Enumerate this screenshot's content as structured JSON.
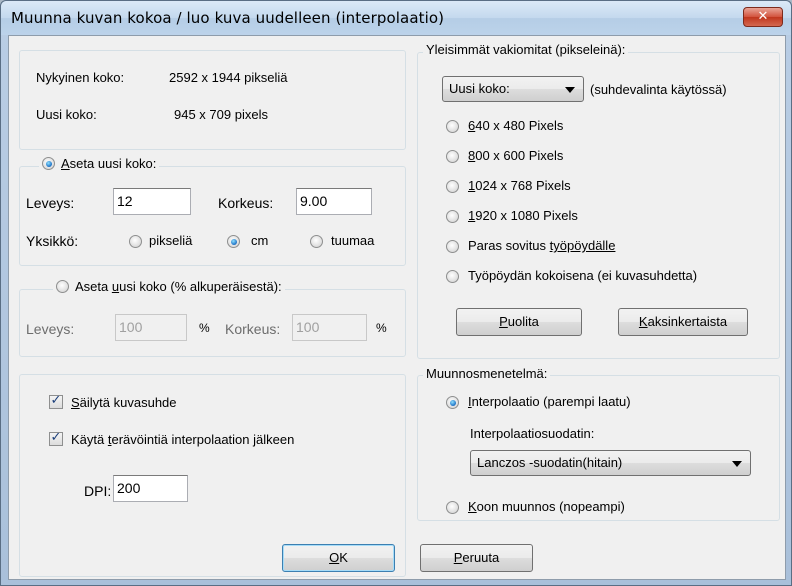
{
  "window": {
    "title": "Muunna kuvan kokoa / luo kuva uudelleen (interpolaatio)",
    "close_label": "✕"
  },
  "current": {
    "current_label": "Nykyinen koko:",
    "current_value": "2592  x  1944  pikseliä",
    "new_label": "Uusi koko:",
    "new_value": "945  x  709  pixels"
  },
  "absolute": {
    "radio_label_u": "A",
    "radio_label_rest": "seta uusi koko:",
    "width_label": "Leveys:",
    "width_value": "12",
    "height_label": "Korkeus:",
    "height_value": "9.00",
    "unit_label": "Yksikkö:",
    "unit_pixels": "pikseliä",
    "unit_cm": "cm",
    "unit_inch": "tuumaa"
  },
  "percent": {
    "radio_label_pre": "Aseta ",
    "radio_label_u": "u",
    "radio_label_rest": "usi koko (% alkuperäisestä):",
    "width_label": "Leveys:",
    "width_value": "100",
    "height_label": "Korkeus:",
    "height_value": "100",
    "percent_sign": "%"
  },
  "options": {
    "keep_ratio_u": "S",
    "keep_ratio_rest": "äilytä kuvasuhde",
    "sharpen_pre": "Käytä ",
    "sharpen_u": "t",
    "sharpen_rest": "erävöintiä interpolaation jälkeen",
    "dpi_label": "DPI:",
    "dpi_value": "200"
  },
  "presets": {
    "group_label": "Yleisimmät vakiomitat (pikseleinä):",
    "dropdown_value": "Uusi koko:",
    "dropdown_note": "(suhdevalinta käytössä)",
    "items": [
      {
        "u": "6",
        "rest": "40 x 480 Pixels"
      },
      {
        "u": "8",
        "rest": "00 x 600 Pixels"
      },
      {
        "u": "1",
        "rest": "024 x 768 Pixels"
      },
      {
        "u": "1",
        "rest": "920 x 1080 Pixels"
      }
    ],
    "fit_pre": "Paras sovitus ",
    "fit_u": "työpöydälle",
    "desktop_label": "Työpöydän kokoisena (ei kuvasuhdetta)",
    "half_u": "P",
    "half_rest": "uolita",
    "double_u": "K",
    "double_rest": "aksinkertaista"
  },
  "method": {
    "group_label": "Muunnosmenetelmä:",
    "interp_u": "I",
    "interp_rest": "nterpolaatio (parempi laatu)",
    "filter_label": "Interpolaatiosuodatin:",
    "filter_value": "Lanczos -suodatin(hitain)",
    "resize_u": "K",
    "resize_rest": "oon muunnos (nopeampi)"
  },
  "buttons": {
    "ok_u": "O",
    "ok_rest": "K",
    "cancel_u": "P",
    "cancel_rest": "eruuta"
  }
}
